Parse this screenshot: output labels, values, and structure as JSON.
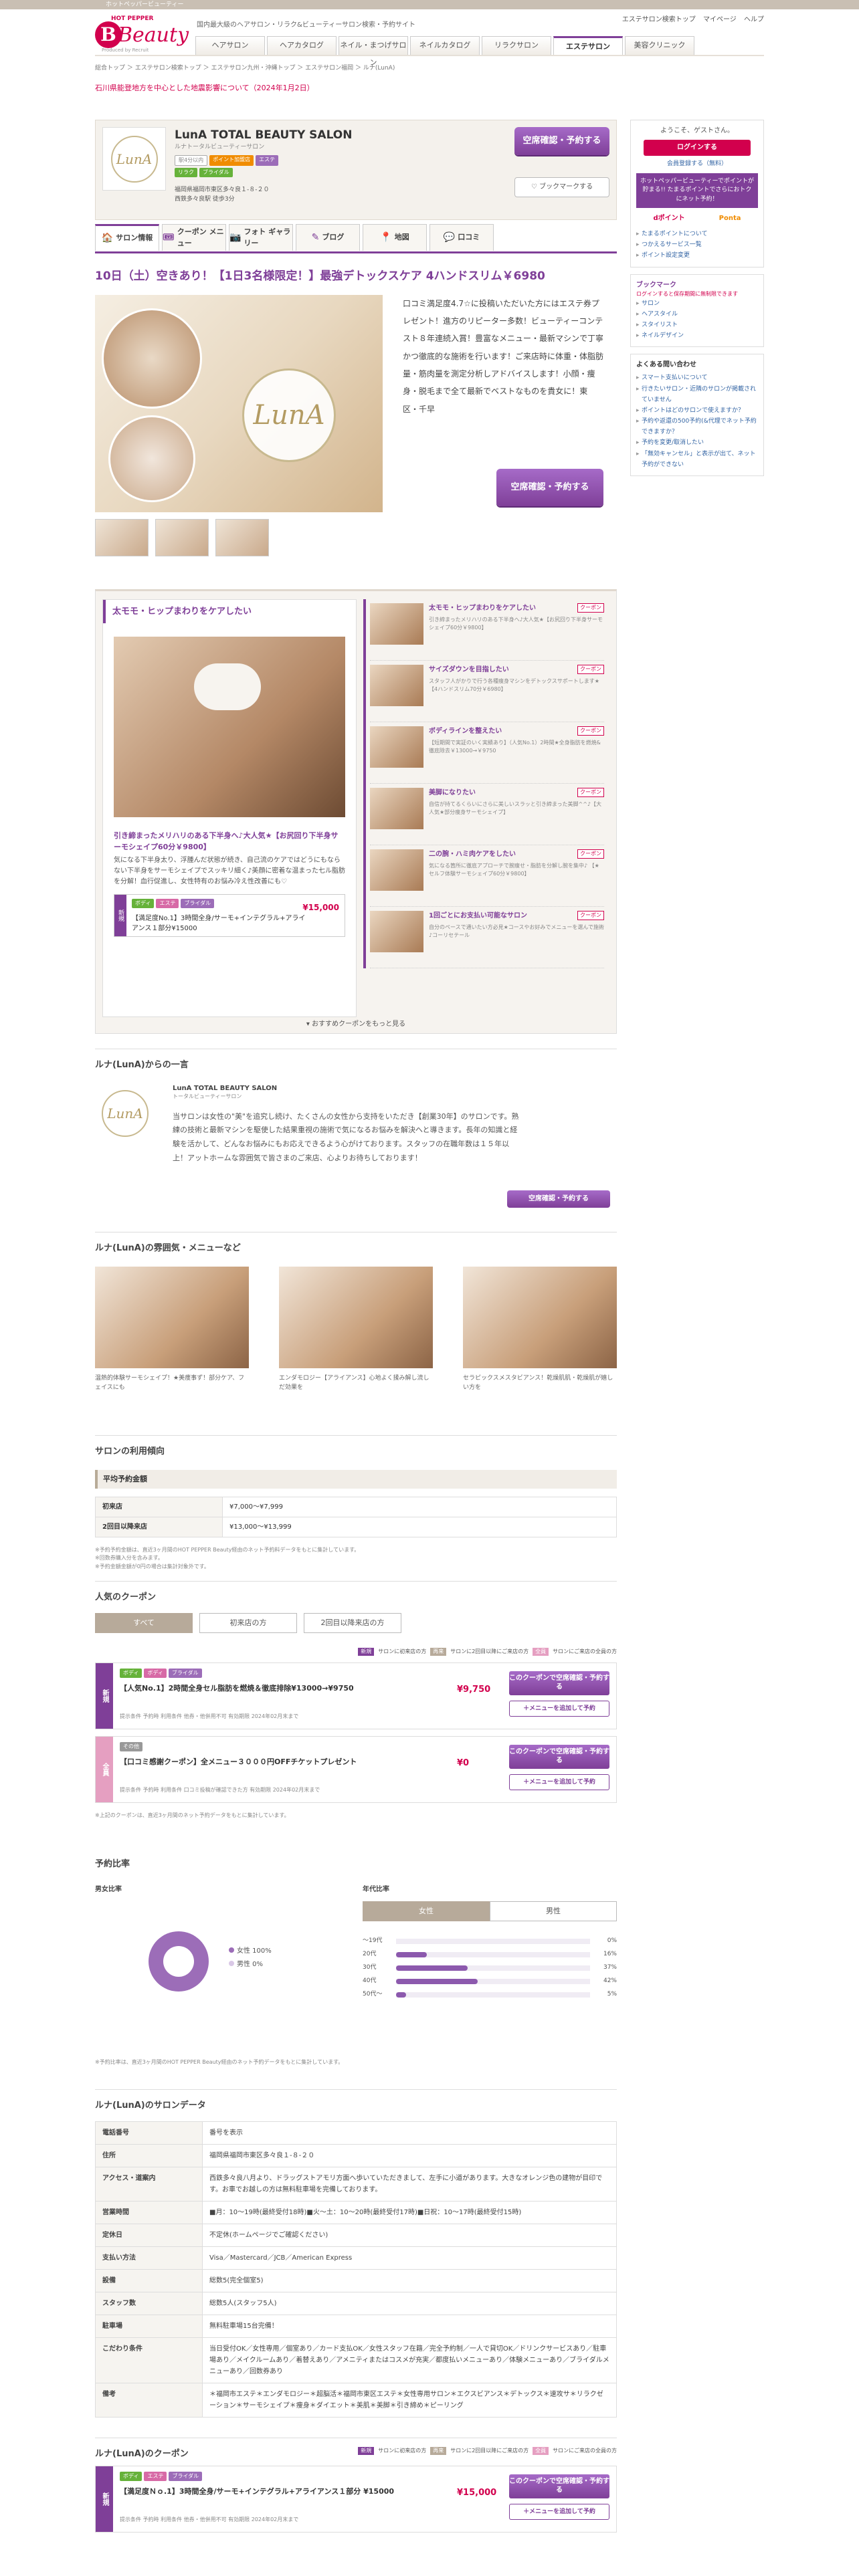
{
  "top_strip": "ホットペッパービューティー",
  "header": {
    "hp": "HOT PEPPER",
    "beauty": "Beauty",
    "by": "Produced by Recruit",
    "tagline": "国内最大級のヘアサロン・リラク&ビューティーサロン検索・予約サイト",
    "links": [
      "エステサロン検索トップ",
      "マイページ",
      "ヘルプ"
    ],
    "nav": [
      "ヘアサロン",
      "ヘアカタログ",
      "ネイル・まつげサロン",
      "ネイルカタログ",
      "リラクサロン",
      "エステサロン",
      "美容クリニック"
    ]
  },
  "breadcrumb": "総合トップ ＞ エステサロン検索トップ ＞ エステサロン九州・沖縄トップ ＞ エステサロン福岡 ＞ ルナ(LunA)",
  "notice": "石川県能登地方を中心とした地震影響について（2024年1月2日）",
  "salon": {
    "logo_text": "LunA",
    "name": "LunA TOTAL BEAUTY SALON",
    "kana": "ルナトータルビューティーサロン",
    "badges": [
      "駅4分以内",
      "ポイント加盟店",
      "エステ",
      "リラク",
      "ブライダル"
    ],
    "address": "福岡県福岡市東区多々良１-８-２０",
    "hours": "西鉄多々良駅 徒歩3分",
    "reserve_btn": "空席確認・予約する",
    "bookmark_btn": "ブックマークする"
  },
  "tabs": [
    {
      "icon": "🏠",
      "label": "サロン情報"
    },
    {
      "icon": "🎟",
      "label": "クーポン メニュー"
    },
    {
      "icon": "📷",
      "label": "フォト ギャラリー"
    },
    {
      "icon": "✎",
      "label": "ブログ"
    },
    {
      "icon": "📍",
      "label": "地図"
    },
    {
      "icon": "💬",
      "label": "口コミ"
    }
  ],
  "catch": "10日（土）空きあり！【1日3名様限定！】最強デトックスケア 4ハンドスリム￥6980",
  "photo_text": "口コミ満足度4.7☆に投稿いただいた方にはエステ券プレゼント！進方のリピーター多数！ビューティーコンテスト８年連続入賞！豊富なメニュー・最新マシンで丁寧かつ徹底的な施術を行います！ご来店時に体重・体脂肪量・筋肉量を測定分析しアドバイスします！小顔・痩身・脱毛まで全て最新でベストなものを貴女に！東区・千早",
  "reserve_btn2": "空席確認・予約する",
  "feature": {
    "title": "太モモ・ヒップまわりをケアしたい",
    "ftitle": "引き締まったメリハリのある下半身へ♪大人気★【お尻回り下半身サーモシェイプ60分￥9800】",
    "fdesc": "気になる下半身太り、浮腫んだ状態が続き、自己流のケアではどうにもならない下半身をサーモシェイプでスッキリ細く♪美顔に密着な温まった七ル脂肪を分解！血行促進し、女性特有のお悩み冷え性改善にも♡",
    "fcats": [
      "ボディ",
      "エステ",
      "ブライダル"
    ],
    "fname": "【満足度No.1】3時間全身/サーモ+インテグラル+アライアンス１部分¥15000",
    "fprice": "¥15,000",
    "ftag": "新規",
    "items": [
      {
        "t": "太モモ・ヒップまわりをケアしたい",
        "lbl": "クーポン",
        "d": "引き締まったメリハリのある下半身へ♪大人気★【お尻回り下半身サーモシェイプ60分￥9800】"
      },
      {
        "t": "サイズダウンを目指したい",
        "lbl": "クーポン",
        "d": "スタッフ人がかりで行う各種痩身マシンをデトックスサポートします★【4ハンドスリム70分￥6980】"
      },
      {
        "t": "ボディラインを整えたい",
        "lbl": "クーポン",
        "d": "【短期間で実証のいく実績あり】（人気No.1）2時間★全身脂肪を燃焼&徹底除去￥13000→￥9750"
      },
      {
        "t": "美脚になりたい",
        "lbl": "クーポン",
        "d": "自信が持てるくらいにさらに美しいスラッと引き締まった美脚^^♪【大人気★部分痩身サーモシェイプ】"
      },
      {
        "t": "二の腕・ハミ肉ケアをしたい",
        "lbl": "クーポン",
        "d": "気になる箇所に徹底アプローチで腕痩せ・脂肪を分解し腕を集中♪ 【★セルフ体験サーモシェイプ60分￥9800】"
      },
      {
        "t": "1回ごとにお支払い可能なサロン",
        "lbl": "クーポン",
        "d": "自分のペースで通いたい方必見★コースやお好みでメニューを選んで施術♪コーリセテール"
      }
    ],
    "more": "おすすめクーポンをもっと見る"
  },
  "intro": {
    "heading": "ルナ(LunA)からの一言",
    "name": "LunA TOTAL BEAUTY SALON",
    "kana": "トータルビューティーサロン",
    "text": "当サロンは女性の\"美\"を追究し続け、たくさんの女性から支持をいただき【創業30年】のサロンです。熟練の技術と最新マシンを駆使した結果重視の施術で気になるお悩みを解決へと導きます。長年の知識と経験を活かして、どんなお悩みにもお応えできるよう心がけております。スタッフの在職年数は１５年以上！アットホームな雰囲気で皆さまのご来店、心よりお待ちしております！",
    "btn": "空席確認・予約する"
  },
  "atmos": {
    "heading": "ルナ(LunA)の雰囲気・メニューなど",
    "items": [
      "温熱的体験サーモシェイプ！★美痩事ず！部分ケア、フェイスにも",
      "エンダモロジー【アライアンス】心地よく揉み解し流しだ効果を",
      "セラピックスメスタビアンス！乾燥肌肌・乾燥肌が嬉しい方を"
    ]
  },
  "trend": {
    "heading": "サロンの利用傾向",
    "box": "平均予約金額",
    "rows": [
      {
        "k": "初来店",
        "v": "¥7,000〜¥7,999"
      },
      {
        "k": "2回目以降来店",
        "v": "¥13,000〜¥13,999"
      }
    ],
    "notes": [
      "※予約予約金額は、直近3ヶ月間のHOT PEPPER Beauty経由のネット予約料データをもとに集計しています。",
      "※回数券購入分を含みます。",
      "※予約金額金額が0円の場合は集計対象外です。"
    ]
  },
  "coupons": {
    "heading": "人気のクーポン",
    "tabs": [
      "すべて",
      "初来店の方",
      "2回目以降来店の方"
    ],
    "legend": [
      {
        "tag": "新規",
        "text": "サロンに初来店の方"
      },
      {
        "tag": "再来",
        "text": "サロンに2回目以降にご来店の方"
      },
      {
        "tag": "全員",
        "text": "サロンにご来店の全員の方"
      }
    ],
    "items": [
      {
        "tag": "新規",
        "cats": [
          "ボディ",
          "ボディ",
          "ブライダル"
        ],
        "name": "【人気No.1】2時間全身セル脂肪を燃焼＆徹底排除¥13000→¥9750",
        "price": "¥9,750",
        "meta": "提示条件 予約時  利用条件 他券・他併用不可  有効期限 2024年02月末まで",
        "btn1": "このクーポンで空席確認・予約する",
        "btn2": "＋メニューを追加して予約"
      },
      {
        "tag": "全員",
        "cats": [
          "その他"
        ],
        "name": "【口コミ感謝クーポン】全メニュー３０００円OFFチケットプレゼント",
        "price": "¥0",
        "meta": "提示条件 予約時  利用条件 口コミ投稿が確認できた方  有効期限 2024年02月末まで",
        "btn1": "このクーポンで空席確認・予約する",
        "btn2": "＋メニューを追加して予約"
      }
    ],
    "note": "※上記のクーポンは、直近3ヶ月間のネット予約データをもとに集計しています。"
  },
  "ratio": {
    "heading": "予約比率",
    "gender_h": "男女比率",
    "female": "女性  100%",
    "male": "男性  0%",
    "female_pct": 100,
    "age_h": "年代比率",
    "gtabs": [
      "女性",
      "男性"
    ],
    "ages": [
      {
        "label": "〜19代",
        "pct": 0,
        "text": "0%"
      },
      {
        "label": "20代",
        "pct": 16,
        "text": "16%"
      },
      {
        "label": "30代",
        "pct": 37,
        "text": "37%"
      },
      {
        "label": "40代",
        "pct": 42,
        "text": "42%"
      },
      {
        "label": "50代〜",
        "pct": 5,
        "text": "5%"
      }
    ],
    "note": "※予約比率は、直近3ヶ月間のHOT PEPPER Beauty経由のネット予約データをもとに集計しています。"
  },
  "salondata": {
    "heading": "ルナ(LunA)のサロンデータ",
    "rows": [
      {
        "k": "電話番号",
        "v": "番号を表示"
      },
      {
        "k": "住所",
        "v": "福岡県福岡市東区多々良１-８-２０"
      },
      {
        "k": "アクセス・道案内",
        "v": "西鉄多々良八月より、ドラッグストアモリ方面へ歩いていただきまして、左手に小道があります。大きなオレンジ色の建物が目印です。お車でお越しの方は無料駐車場を完備しております。"
      },
      {
        "k": "営業時間",
        "v": "■月：10〜19時(最終受付18時)■火〜土：10〜20時(最終受付17時)■日祝：10〜17時(最終受付15時)"
      },
      {
        "k": "定休日",
        "v": "不定休(ホームページでご確認ください)"
      },
      {
        "k": "支払い方法",
        "v": "Visa／Mastercard／JCB／American Express"
      },
      {
        "k": "設備",
        "v": "総数5(完全個室5)"
      },
      {
        "k": "スタッフ数",
        "v": "総数5人(スタッフ5人)"
      },
      {
        "k": "駐車場",
        "v": "無料駐車場15台完備！"
      },
      {
        "k": "こだわり条件",
        "v": "当日受付OK／女性専用／個室あり／カード支払OK／女性スタッフ在籍／完全予約制／一人で貸切OK／ドリンクサービスあり／駐車場あり／メイクルームあり／着替えあり／アメニティまたはコスメが充実／都度払いメニューあり／体験メニューあり／ブライダルメニューあり／回数券あり"
      },
      {
        "k": "備考",
        "v": "＊福岡市エステ＊エンダモロジー＊超脳活＊福岡市東区エステ＊女性専用サロン＊エクスビアンス＊デトックス＊速攻サ＊リラクゼーション＊サーモシェイプ＊痩身＊ダイエット＊美肌＊美脚＊引き締め＊ピーリング"
      }
    ]
  },
  "coupons2": {
    "heading": "ルナ(LunA)のクーポン",
    "item": {
      "tag": "新規",
      "cats": [
        "ボディ",
        "エステ",
        "ブライダル"
      ],
      "name": "【満足度Ｎｏ.1】3時間全身/サーモ+インテグラル+アライアンス１部分 ¥15000",
      "price": "¥15,000",
      "meta": "提示条件 予約時  利用条件 他券・他併用不可  有効期限 2024年02月末まで",
      "btn1": "このクーポンで空席確認・予約する",
      "btn2": "＋メニューを追加して予約"
    }
  },
  "sidebar": {
    "welcome": "ようこそ、ゲストさん。",
    "login": "ログインする",
    "register": "会員登録する（無料）",
    "promo": "ホットペッパービューティーでポイントが貯まる!!\nたまるポイントでさらにおトクにネット予約！",
    "points": [
      "dポイント",
      "Ponta"
    ],
    "links1": [
      "たまるポイントについて",
      "つかえるサービス一覧",
      "ポイント設定変更"
    ],
    "bk_title": "ブックマーク",
    "bk_note": "ログインすると保存期間に無制限できます",
    "bk_links": [
      "サロン",
      "ヘアスタイル",
      "スタイリスト",
      "ネイルデザイン"
    ],
    "faq_h": "よくある問い合わせ",
    "faq": [
      "スマート支払いについて",
      "行きたいサロン・近隣のサロンが掲載されていません",
      "ポイントはどのサロンで使えますか？",
      "予約や返還の500予約(&代理でネット予約できますか？",
      "予約を変更/取消したい",
      "「無効キャンセル」と表示が出て、ネット予約ができない"
    ]
  }
}
